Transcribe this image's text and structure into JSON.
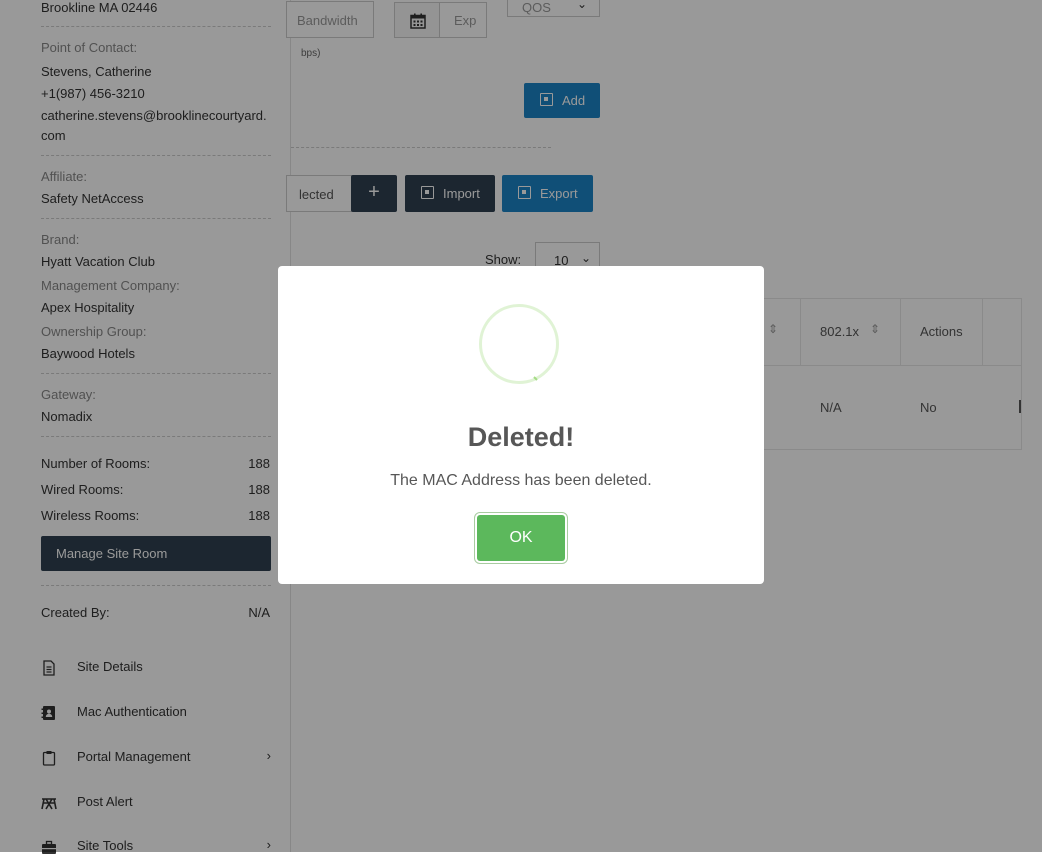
{
  "sidebar": {
    "address": "Brookline MA 02446",
    "contact_label": "Point of Contact:",
    "contact_name": "Stevens, Catherine",
    "contact_phone": "+1(987) 456-3210",
    "contact_email_line1": "catherine.stevens@brooklinecourtyard.",
    "contact_email_line2": "com",
    "affiliate_label": "Affiliate:",
    "affiliate_value": "Safety NetAccess",
    "brand_label": "Brand:",
    "brand_value": "Hyatt Vacation Club",
    "mgmt_label": "Management Company:",
    "mgmt_value": "Apex Hospitality",
    "ownership_label": "Ownership Group:",
    "ownership_value": "Baywood Hotels",
    "gateway_label": "Gateway:",
    "gateway_value": "Nomadix",
    "rooms_label": "Number of Rooms:",
    "rooms_value": "188",
    "wired_label": "Wired Rooms:",
    "wired_value": "188",
    "wireless_label": "Wireless Rooms:",
    "wireless_value": "188",
    "manage_button": "Manage Site Room",
    "created_label": "Created By:",
    "created_value": "N/A",
    "nav": [
      {
        "label": "Site Details",
        "icon": "document-icon"
      },
      {
        "label": "Mac Authentication",
        "icon": "address-book-icon"
      },
      {
        "label": "Portal Management",
        "icon": "clipboard-icon"
      },
      {
        "label": "Post Alert",
        "icon": "alert-icon"
      },
      {
        "label": "Site Tools",
        "icon": "toolbox-icon"
      }
    ]
  },
  "form": {
    "bandwidth_placeholder": "Bandwidth",
    "bandwidth_hint": "bps)",
    "expiry_placeholder": "Exp",
    "qos_value": "QOS",
    "add_button": "Add"
  },
  "toolbar": {
    "selected_fragment": "lected",
    "plus": "+",
    "import_button": "Import",
    "export_button": "Export",
    "show_label": "Show:",
    "show_value": "10"
  },
  "table": {
    "headers": [
      "802.1x",
      "Actions"
    ],
    "row": [
      "N/A",
      "No"
    ]
  },
  "modal": {
    "title": "Deleted!",
    "text": "The MAC Address has been deleted.",
    "ok_button": "OK"
  },
  "colors": {
    "primary": "#1c84c6",
    "dark": "#2f4050",
    "success": "#5cb85c"
  }
}
